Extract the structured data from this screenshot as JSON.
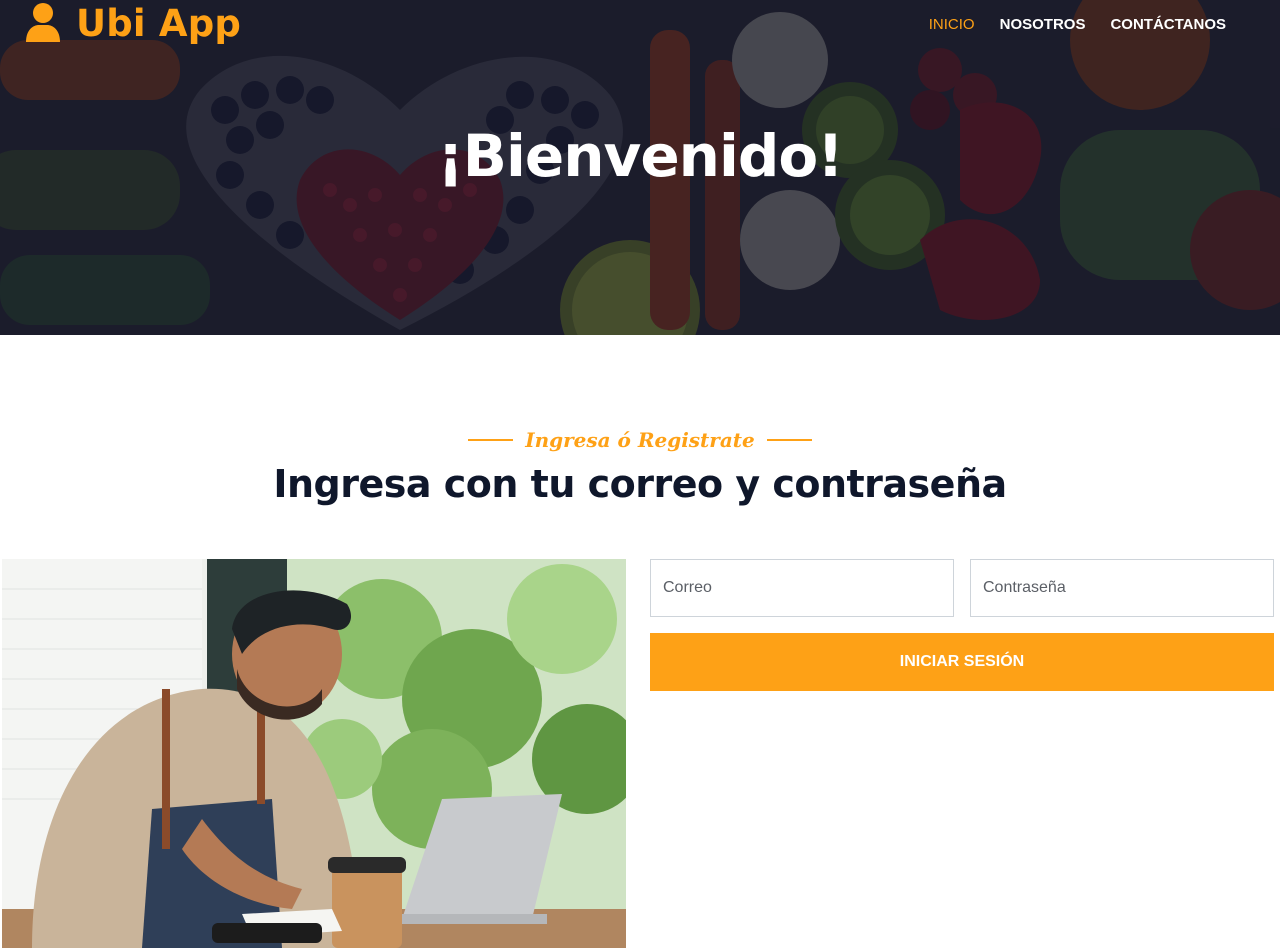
{
  "brand": {
    "name": "Ubi App",
    "icon": "user-icon",
    "color": "#fea116"
  },
  "nav": {
    "items": [
      {
        "label": "INICIO",
        "active": true
      },
      {
        "label": "NOSOTROS",
        "active": false
      },
      {
        "label": "CONTÁCTANOS",
        "active": false
      }
    ]
  },
  "hero": {
    "title": "¡Bienvenido!"
  },
  "section": {
    "eyebrow": "Ingresa ó Registrate",
    "title": "Ingresa con tu correo y contraseña"
  },
  "form": {
    "email_placeholder": "Correo",
    "password_placeholder": "Contraseña",
    "submit_label": "INICIAR SESIÓN"
  },
  "colors": {
    "accent": "#fea116",
    "heading": "#0f172b",
    "hero_overlay": "#0f1123"
  }
}
